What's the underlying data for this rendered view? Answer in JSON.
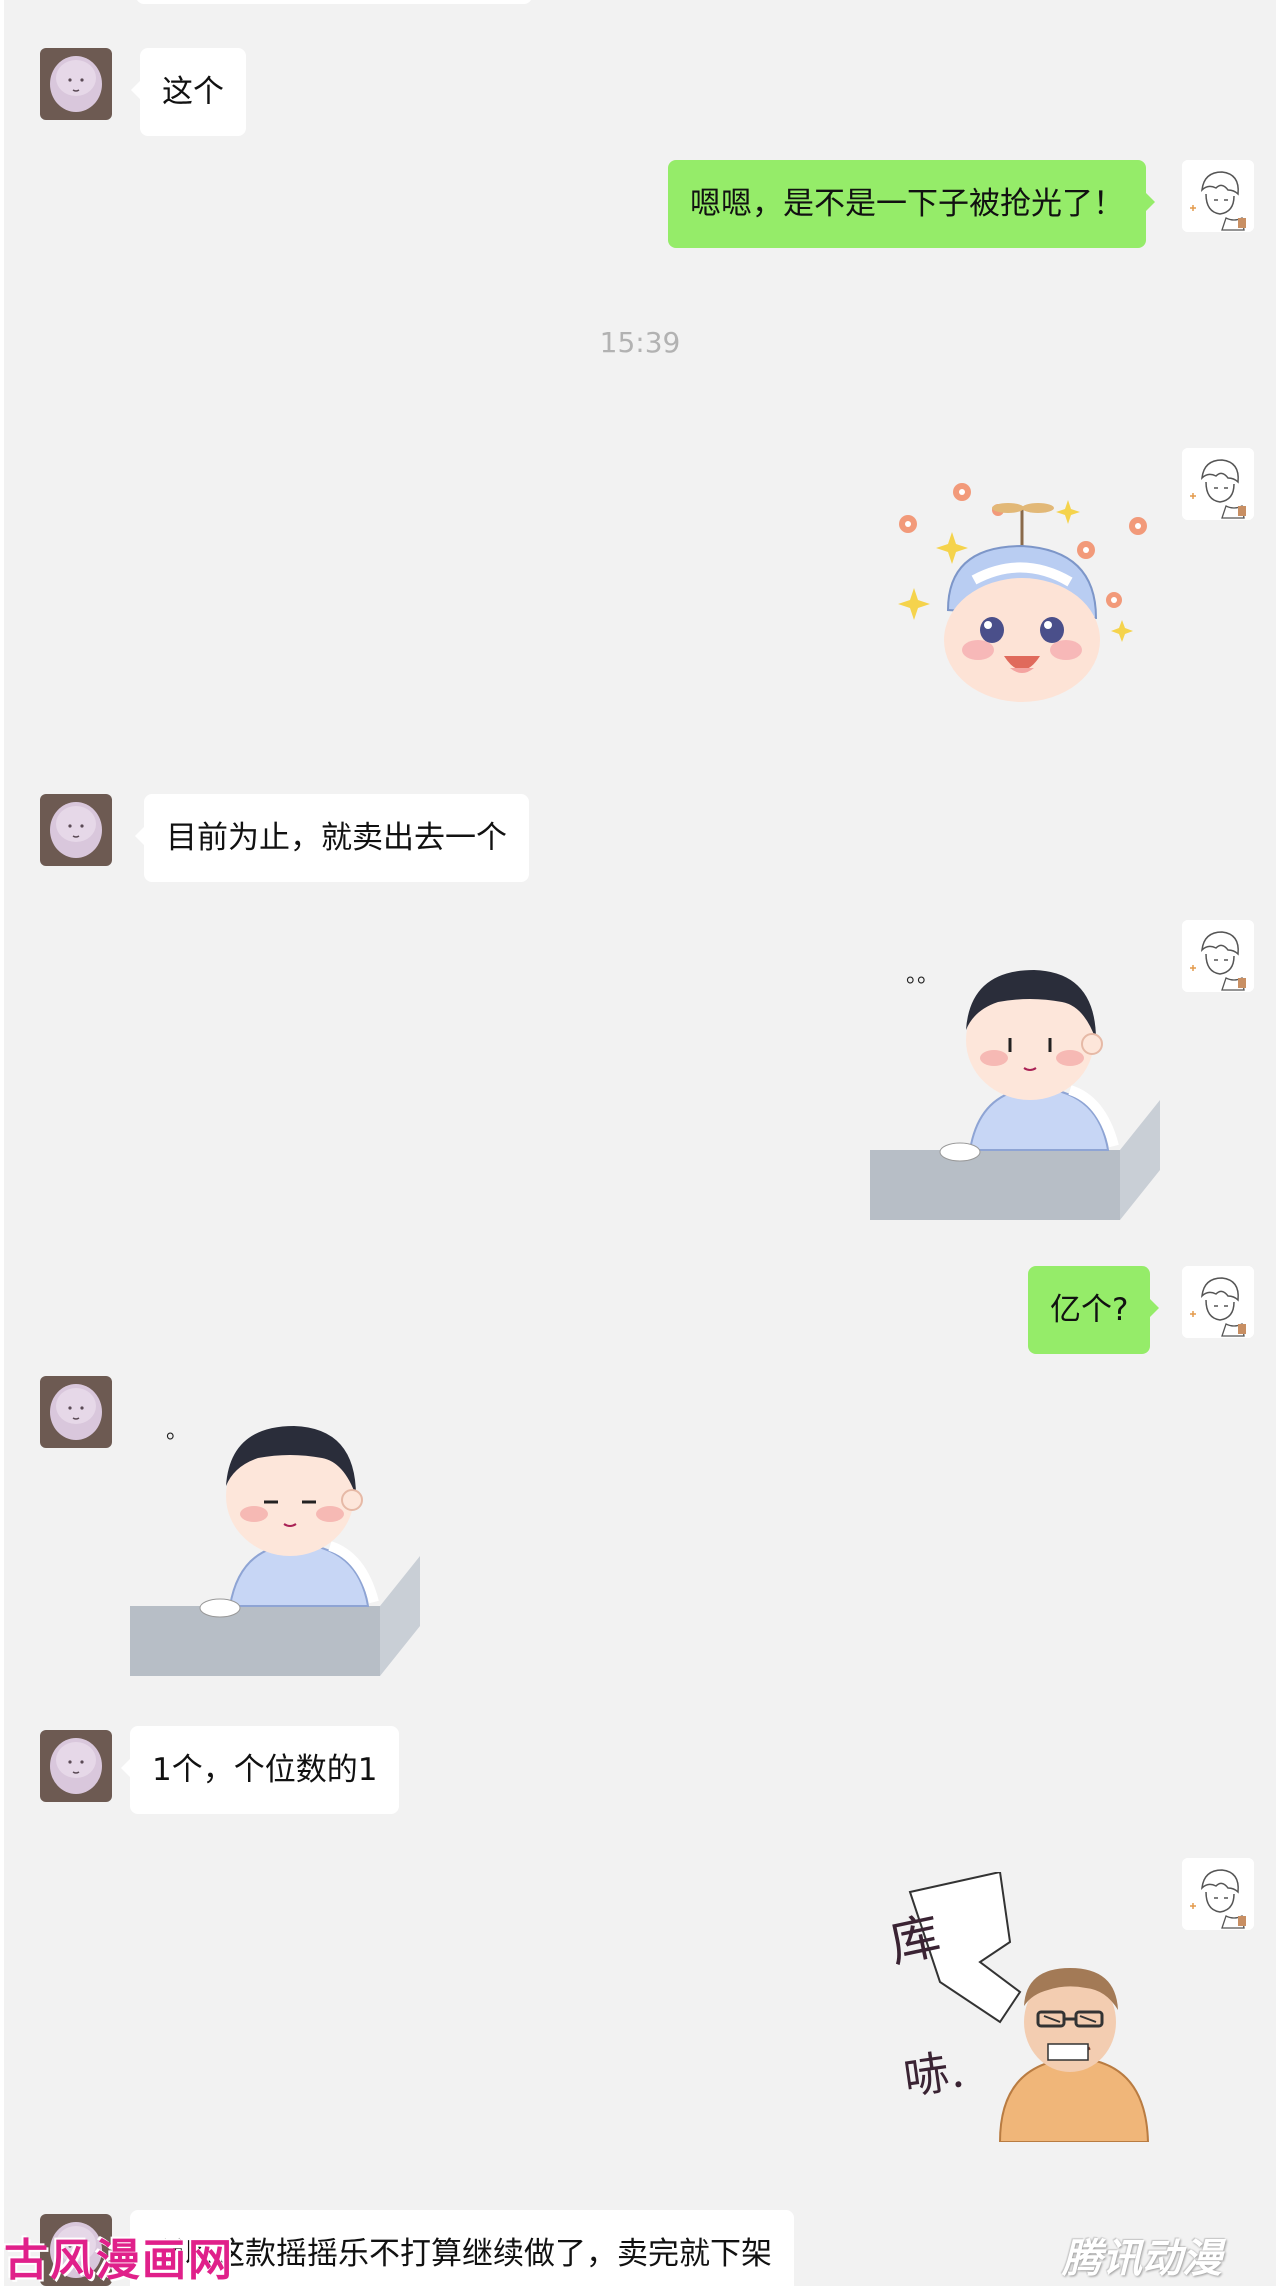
{
  "colors": {
    "chat_background": "#f2f2f2",
    "incoming_bubble": "#ffffff",
    "outgoing_bubble": "#95ec69",
    "timestamp_text": "#b2b2b2"
  },
  "messages": [
    {
      "id": "m1",
      "direction": "in",
      "type": "text",
      "text": "这个"
    },
    {
      "id": "m2",
      "direction": "out",
      "type": "text",
      "text": "嗯嗯，是不是一下子被抢光了！"
    },
    {
      "id": "m3",
      "direction": "out",
      "type": "sticker",
      "sticker": "excited-boy-propeller-cap-sticker"
    },
    {
      "id": "m4",
      "direction": "in",
      "type": "text",
      "text": "目前为止，就卖出去一个"
    },
    {
      "id": "m5",
      "direction": "out",
      "type": "sticker",
      "sticker": "boy-at-desk-sticker",
      "caption": "。。"
    },
    {
      "id": "m6",
      "direction": "out",
      "type": "text",
      "text": "亿个?"
    },
    {
      "id": "m7",
      "direction": "in",
      "type": "sticker",
      "sticker": "boy-at-desk-sticker",
      "caption": "。"
    },
    {
      "id": "m8",
      "direction": "in",
      "type": "text",
      "text": "1个，个位数的1"
    },
    {
      "id": "m9",
      "direction": "out",
      "type": "sticker",
      "sticker": "man-with-glasses-sticker",
      "caption_top": "库",
      "caption_bottom": "哧."
    },
    {
      "id": "m10",
      "direction": "in",
      "type": "text",
      "text": "所以这款摇摇乐不打算继续做了，卖完就下架"
    }
  ],
  "timestamp": "15:39",
  "watermarks": {
    "left": "古风漫画网",
    "right": "腾讯动漫"
  }
}
